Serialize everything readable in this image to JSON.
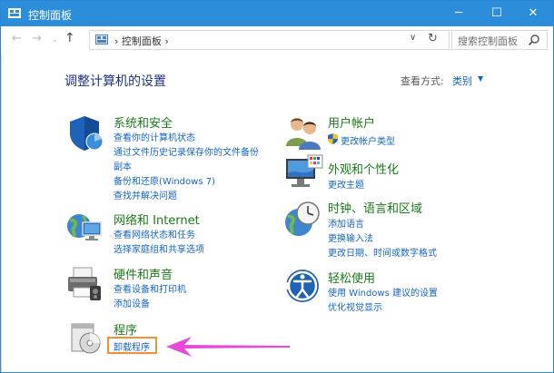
{
  "window": {
    "title": "控制面板",
    "minimize": "─",
    "maximize": "☐",
    "close": "✕"
  },
  "nav": {
    "back": "←",
    "forward": "→",
    "history": "⌄",
    "up": "↑",
    "address": "› 控制面板 ›",
    "dropdown": "∨",
    "refresh": "↻",
    "search_placeholder": "搜索控制面板"
  },
  "main": {
    "heading": "调整计算机的设置",
    "view_by_label": "查看方式:",
    "view_by_value": "类别",
    "view_by_caret": "▼"
  },
  "left_categories": [
    {
      "title": "系统和安全",
      "icon": "security-shield-icon",
      "links": [
        "查看你的计算机状态",
        "通过文件历史记录保存你的文件备份",
        "副本",
        "备份和还原(Windows 7)",
        "查找并解决问题"
      ]
    },
    {
      "title": "网络和 Internet",
      "icon": "network-globe-icon",
      "links": [
        "查看网络状态和任务",
        "选择家庭组和共享选项"
      ]
    },
    {
      "title": "硬件和声音",
      "icon": "printer-icon",
      "links": [
        "查看设备和打印机",
        "添加设备"
      ]
    },
    {
      "title": "程序",
      "icon": "programs-icon",
      "links": [
        "卸载程序"
      ]
    }
  ],
  "right_categories": [
    {
      "title": "用户帐户",
      "icon": "users-icon",
      "links": [
        "更改帐户类型"
      ]
    },
    {
      "title": "外观和个性化",
      "icon": "monitor-palette-icon",
      "links": [
        "更改主题"
      ]
    },
    {
      "title": "时钟、语言和区域",
      "icon": "clock-globe-icon",
      "links": [
        "添加语言",
        "更换输入法",
        "更改日期、时间或数字格式"
      ]
    },
    {
      "title": "轻松使用",
      "icon": "ease-of-access-icon",
      "links": [
        "使用 Windows 建议的设置",
        "优化视觉显示"
      ]
    }
  ],
  "colors": {
    "titlebar": "#2c8ddb",
    "link": "#1565c0",
    "category_title": "#1a7a1a",
    "highlight": "#f0913a",
    "arrow": "#e64ad8"
  }
}
